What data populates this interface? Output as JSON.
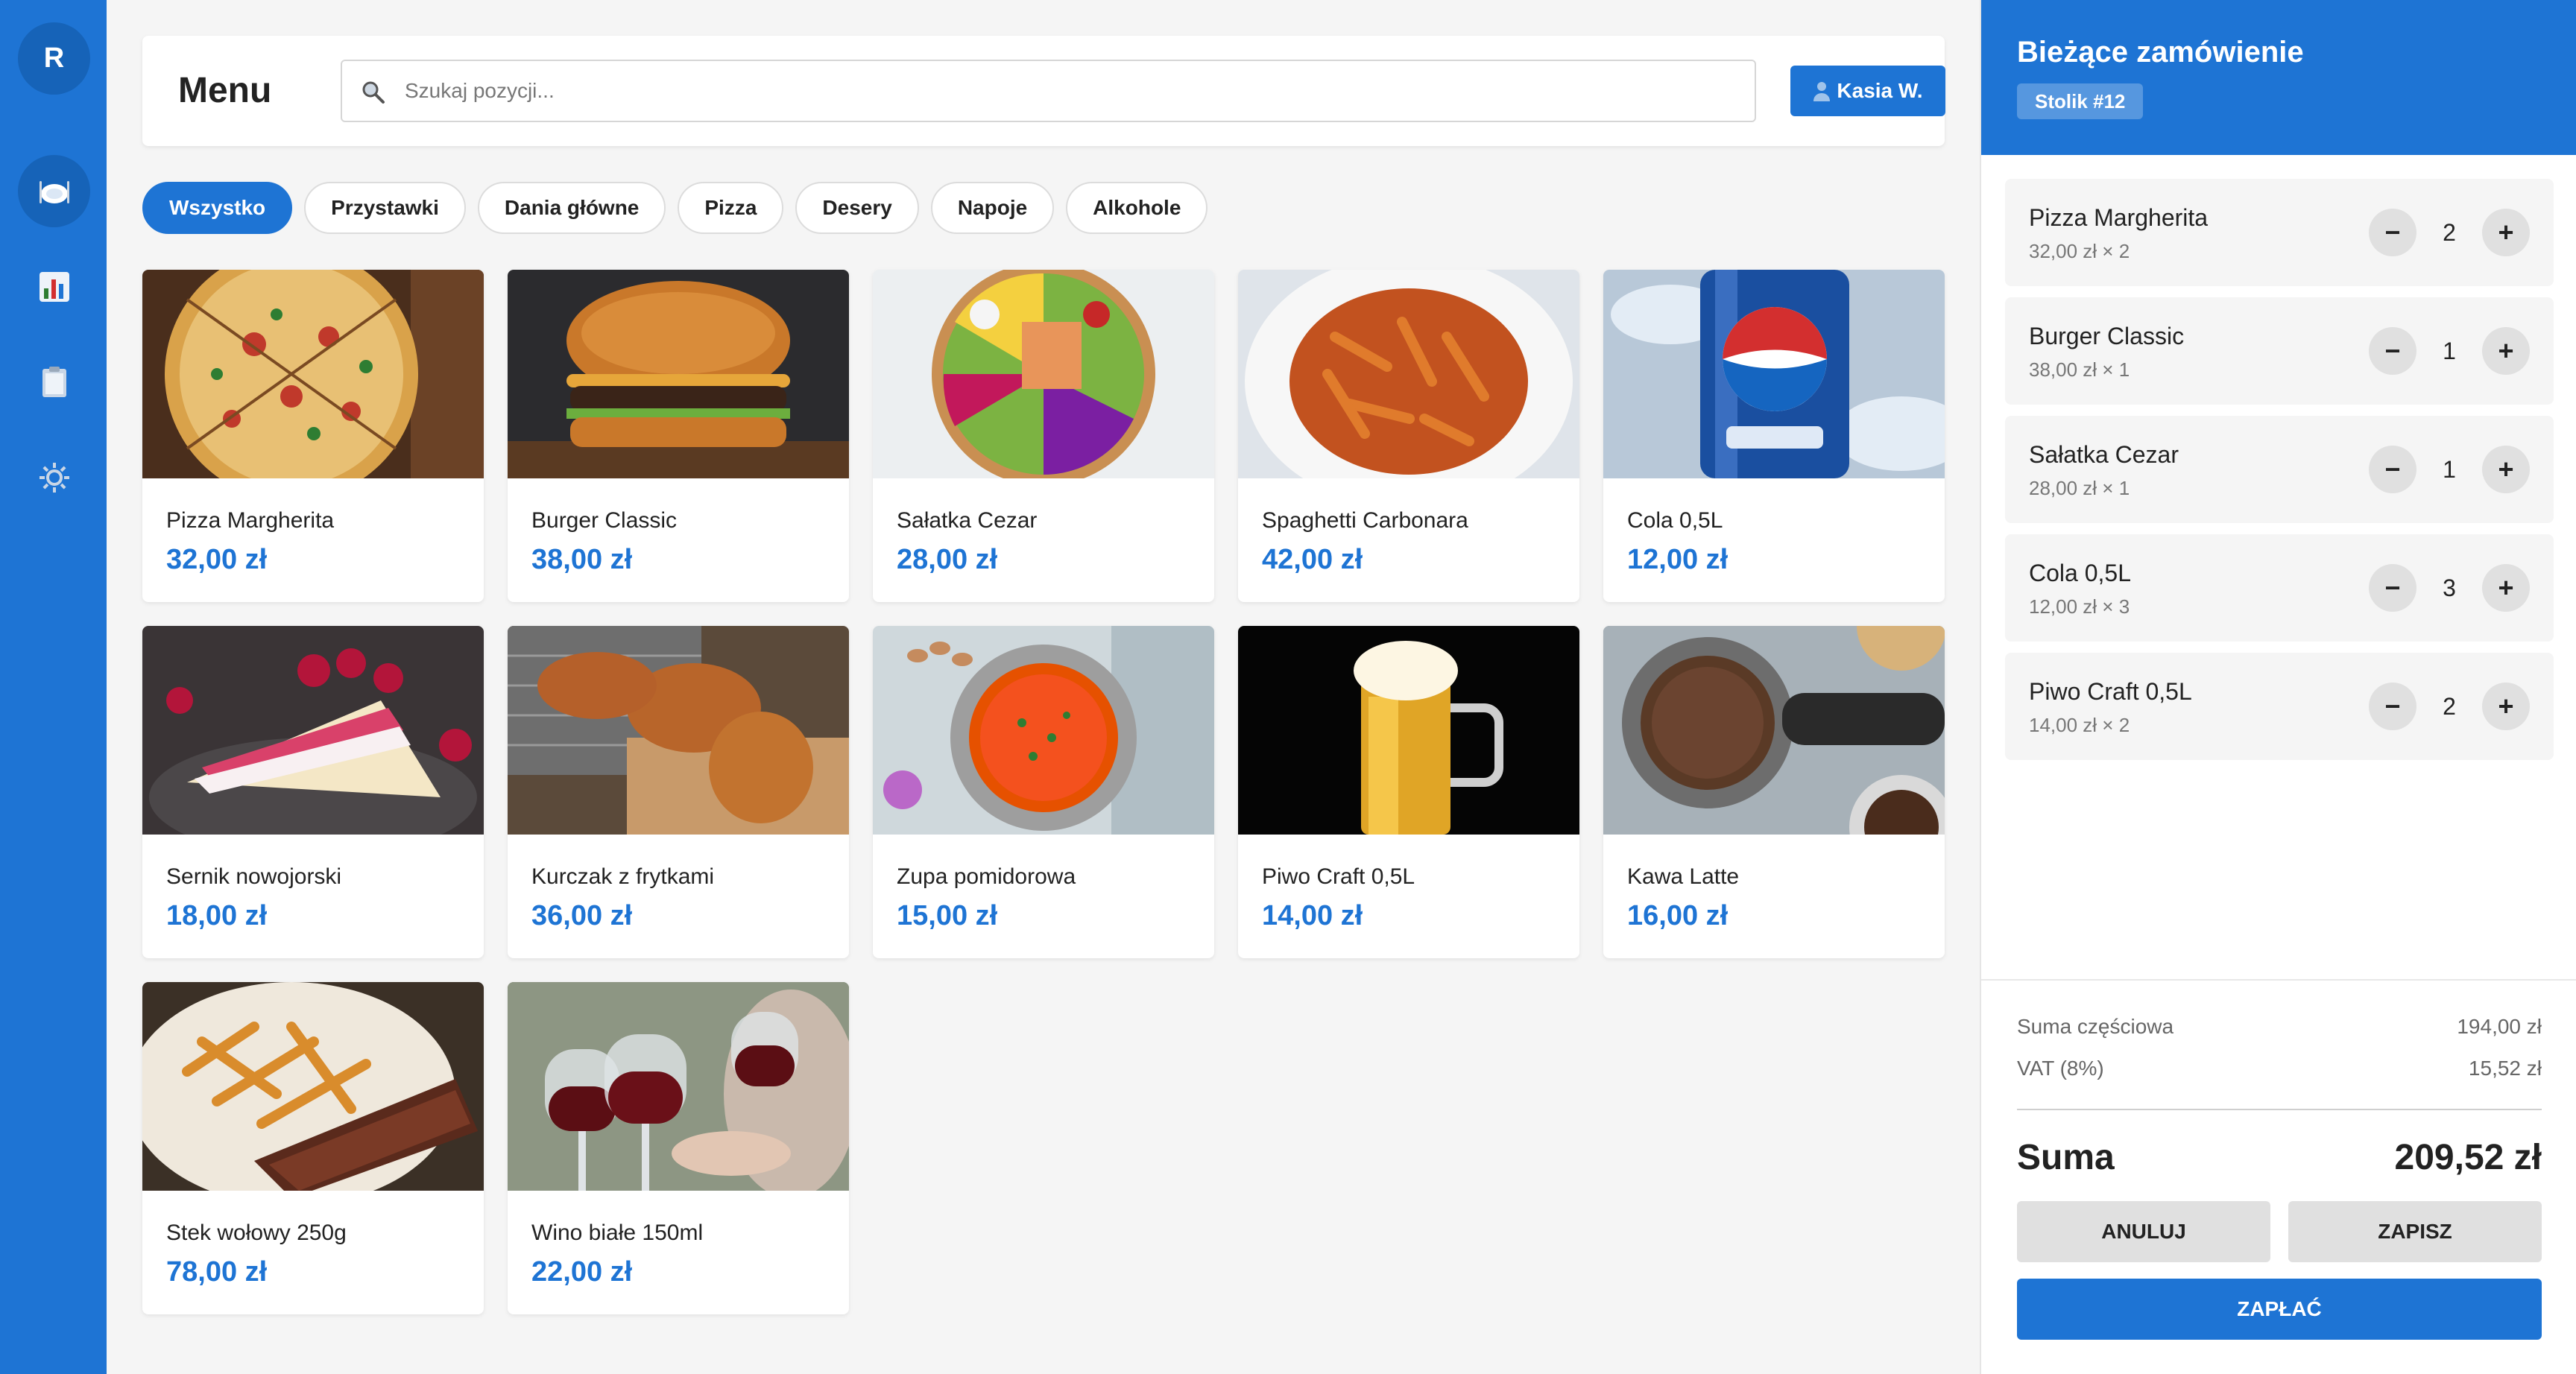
{
  "colors": {
    "accent": "#1e74d4",
    "rail": "#1e74d4",
    "price": "#1e74d4"
  },
  "rail": {
    "avatar_letter": "R",
    "nav": [
      {
        "icon": "plate-icon",
        "active": true
      },
      {
        "icon": "chart-icon",
        "active": false
      },
      {
        "icon": "clipboard-icon",
        "active": false
      },
      {
        "icon": "gear-icon",
        "active": false
      }
    ]
  },
  "header": {
    "title": "Menu",
    "search_placeholder": "Szukaj pozycji...",
    "search_value": "",
    "user_label": "Kasia W."
  },
  "categories": [
    {
      "label": "Wszystko",
      "active": true
    },
    {
      "label": "Przystawki",
      "active": false
    },
    {
      "label": "Dania główne",
      "active": false
    },
    {
      "label": "Pizza",
      "active": false
    },
    {
      "label": "Desery",
      "active": false
    },
    {
      "label": "Napoje",
      "active": false
    },
    {
      "label": "Alkohole",
      "active": false
    }
  ],
  "menu_items": [
    {
      "name": "Pizza Margherita",
      "price": "32,00 zł",
      "image": "pizza"
    },
    {
      "name": "Burger Classic",
      "price": "38,00 zł",
      "image": "burger"
    },
    {
      "name": "Sałatka Cezar",
      "price": "28,00 zł",
      "image": "salad"
    },
    {
      "name": "Spaghetti Carbonara",
      "price": "42,00 zł",
      "image": "pasta"
    },
    {
      "name": "Cola 0,5L",
      "price": "12,00 zł",
      "image": "cola"
    },
    {
      "name": "Sernik nowojorski",
      "price": "18,00 zł",
      "image": "cake"
    },
    {
      "name": "Kurczak z frytkami",
      "price": "36,00 zł",
      "image": "chicken"
    },
    {
      "name": "Zupa pomidorowa",
      "price": "15,00 zł",
      "image": "soup"
    },
    {
      "name": "Piwo Craft 0,5L",
      "price": "14,00 zł",
      "image": "beer"
    },
    {
      "name": "Kawa Latte",
      "price": "16,00 zł",
      "image": "coffee"
    },
    {
      "name": "Stek wołowy 250g",
      "price": "78,00 zł",
      "image": "steak"
    },
    {
      "name": "Wino białe 150ml",
      "price": "22,00 zł",
      "image": "wine"
    }
  ],
  "order": {
    "title": "Bieżące zamówienie",
    "table": "Stolik #12",
    "items": [
      {
        "name": "Pizza Margherita",
        "detail": "32,00 zł × 2",
        "qty": "2"
      },
      {
        "name": "Burger Classic",
        "detail": "38,00 zł × 1",
        "qty": "1"
      },
      {
        "name": "Sałatka Cezar",
        "detail": "28,00 zł × 1",
        "qty": "1"
      },
      {
        "name": "Cola 0,5L",
        "detail": "12,00 zł × 3",
        "qty": "3"
      },
      {
        "name": "Piwo Craft 0,5L",
        "detail": "14,00 zł × 2",
        "qty": "2"
      }
    ],
    "minus_label": "−",
    "plus_label": "+",
    "subtotal_label": "Suma częściowa",
    "subtotal_value": "194,00 zł",
    "vat_label": "VAT (8%)",
    "vat_value": "15,52 zł",
    "total_label": "Suma",
    "total_value": "209,52 zł",
    "cancel_label": "ANULUJ",
    "save_label": "ZAPISZ",
    "pay_label": "ZAPŁAĆ"
  }
}
